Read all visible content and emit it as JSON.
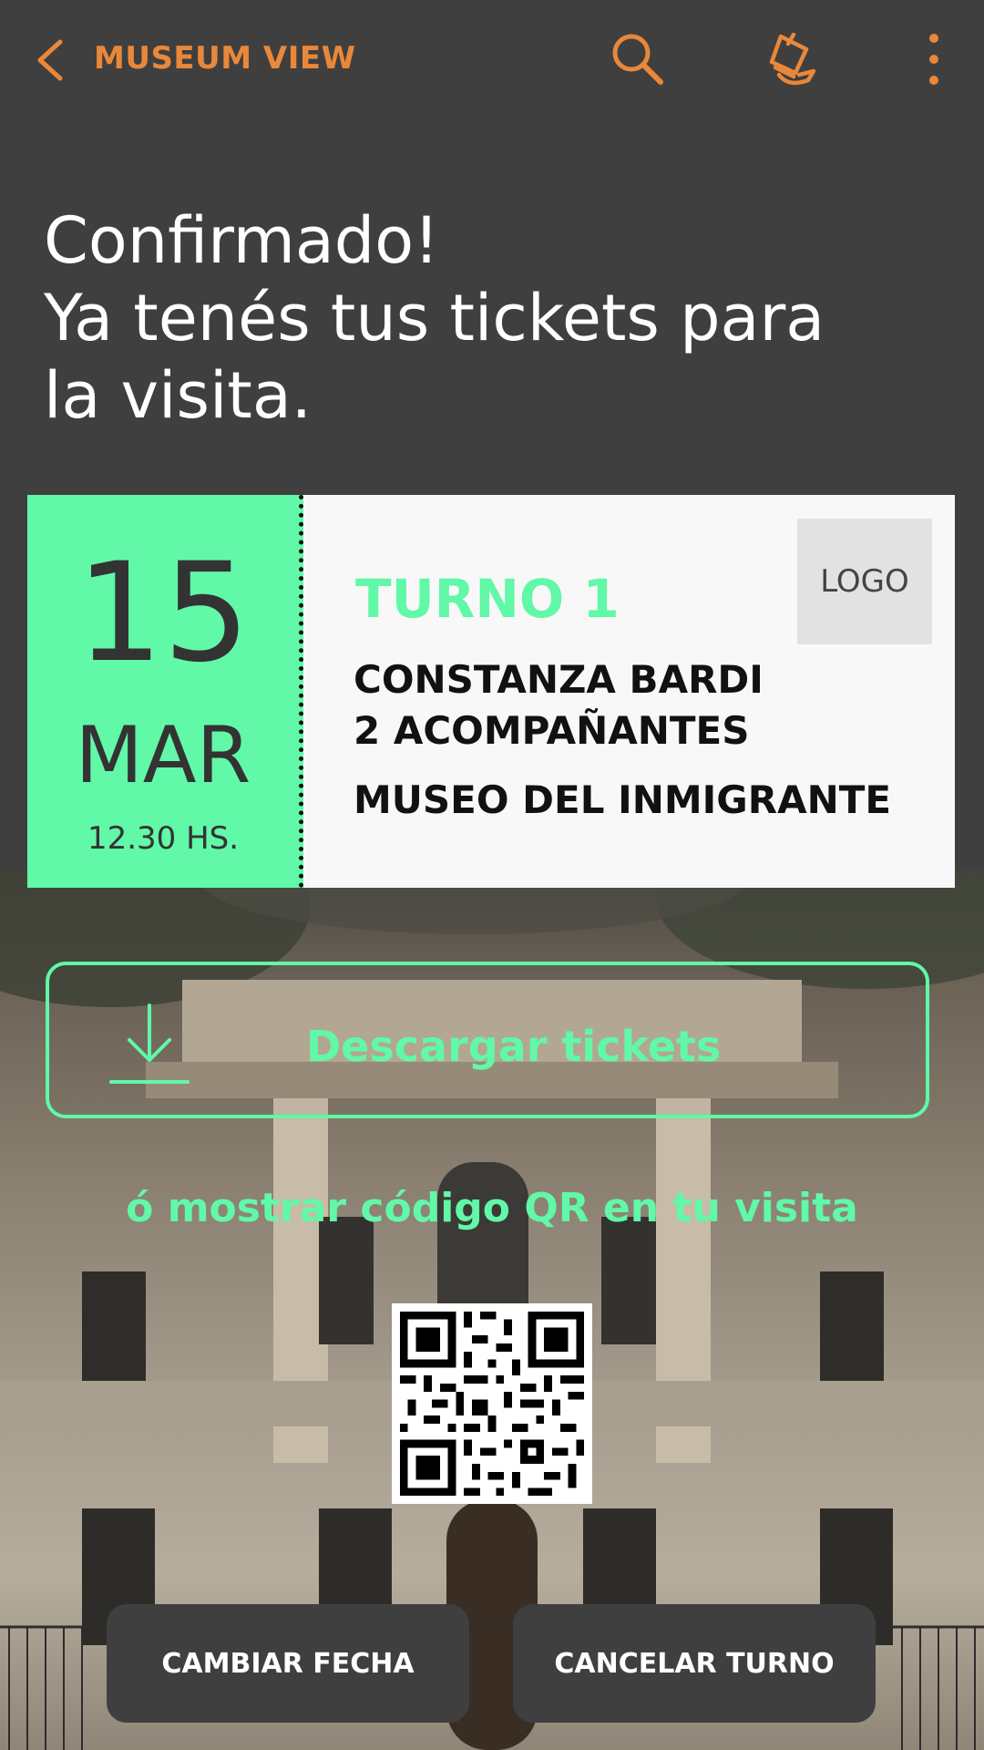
{
  "app": {
    "title": "MUSEUM VIEW"
  },
  "icons": {
    "back": "chevron-left-icon",
    "search": "search-icon",
    "theme": "brush-icon",
    "more": "more-vertical-icon",
    "download": "download-icon",
    "qr": "qr-code"
  },
  "headline": {
    "line1": "Confirmado!",
    "line2": "Ya tenés tus tickets para",
    "line3": "la visita."
  },
  "ticket": {
    "day": "15",
    "month": "MAR",
    "time": "12.30 HS.",
    "turno": "TURNO 1",
    "visitor_name": "CONSTANZA BARDI",
    "companions": "2 ACOMPAÑANTES",
    "museum": "MUSEO DEL INMIGRANTE",
    "logo_text": "LOGO"
  },
  "download": {
    "label": "Descargar tickets"
  },
  "qr_hint": "ó mostrar código QR en tu visita",
  "buttons": {
    "change_date": "CAMBIAR FECHA",
    "cancel": "CANCELAR TURNO"
  },
  "colors": {
    "accent": "#e9883a",
    "mint": "#61f8a8",
    "dark": "#3f3f3f"
  }
}
